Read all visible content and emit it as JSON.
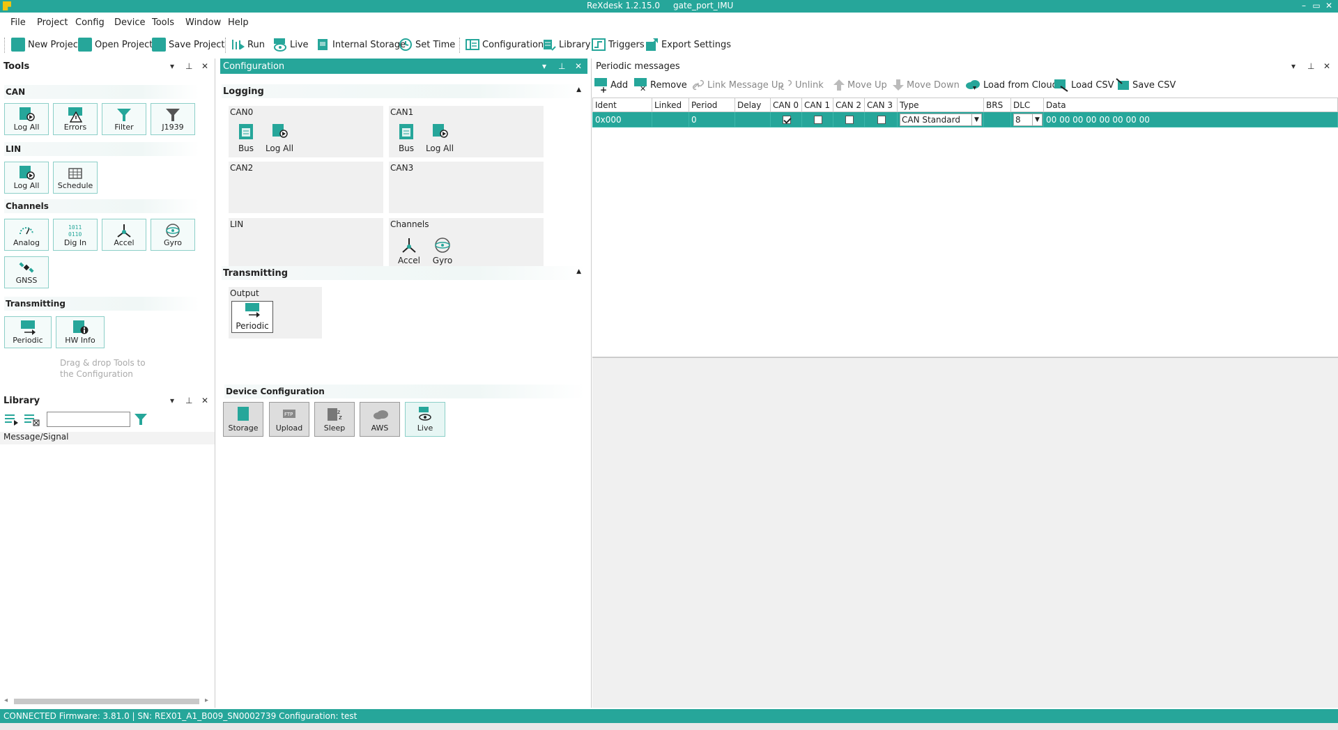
{
  "window": {
    "title": "ReXdesk 1.2.15.0",
    "project": "gate_port_IMU",
    "controls": [
      "–",
      "▭",
      "✕"
    ]
  },
  "menu": [
    "File",
    "Project",
    "Config",
    "Device",
    "Tools",
    "Window",
    "Help"
  ],
  "toolbar": {
    "new_project": "New Project",
    "open_project": "Open Project",
    "save_project": "Save Project",
    "run": "Run",
    "live": "Live",
    "internal_storage": "Internal Storage",
    "set_time": "Set Time",
    "configuration": "Configuration",
    "library": "Library",
    "triggers": "Triggers",
    "export_settings": "Export Settings"
  },
  "tools_panel": {
    "title": "Tools",
    "sections": {
      "can": "CAN",
      "lin": "LIN",
      "channels": "Channels",
      "transmitting": "Transmitting"
    },
    "can_items": [
      "Log All",
      "Errors",
      "Filter",
      "J1939"
    ],
    "lin_items": [
      "Log All",
      "Schedule"
    ],
    "channel_items": [
      "Analog",
      "Dig In",
      "Accel",
      "Gyro",
      "GNSS"
    ],
    "transmit_items": [
      "Periodic",
      "HW Info"
    ],
    "hint": "Drag & drop Tools to the Configuration"
  },
  "library_panel": {
    "title": "Library",
    "search_value": "",
    "column": "Message/Signal"
  },
  "config_panel": {
    "title": "Configuration",
    "logging": "Logging",
    "boxes": {
      "can0": "CAN0",
      "can1": "CAN1",
      "can2": "CAN2",
      "can3": "CAN3",
      "lin": "LIN",
      "channels": "Channels"
    },
    "can0_items": [
      "Bus",
      "Log All"
    ],
    "can1_items": [
      "Bus",
      "Log All"
    ],
    "channels_items": [
      "Accel",
      "Gyro"
    ],
    "transmitting": "Transmitting",
    "output": "Output",
    "output_items": [
      "Periodic"
    ],
    "device_configuration": "Device Configuration",
    "device_items": [
      "Storage",
      "Upload",
      "Sleep",
      "AWS",
      "Live"
    ]
  },
  "periodic_panel": {
    "title": "Periodic messages",
    "toolbar": {
      "add": "Add",
      "remove": "Remove",
      "link_up": "Link Message Up",
      "unlink": "Unlink",
      "move_up": "Move Up",
      "move_down": "Move Down",
      "load_cloud": "Load from Cloud",
      "load_csv": "Load CSV",
      "save_csv": "Save CSV"
    },
    "columns": [
      "Ident",
      "Linked",
      "Period",
      "Delay",
      "CAN 0",
      "CAN 1",
      "CAN 2",
      "CAN 3",
      "Type",
      "BRS",
      "DLC",
      "Data"
    ],
    "rows": [
      {
        "ident": "0x000",
        "linked": "",
        "period": "0",
        "delay": "",
        "can0": true,
        "can1": false,
        "can2": false,
        "can3": false,
        "type": "CAN Standard",
        "brs": "",
        "dlc": "8",
        "data": "00 00 00 00 00 00 00 00"
      }
    ]
  },
  "status": {
    "text": "CONNECTED  Firmware: 3.81.0   |  SN: REX01_A1_B009_SN0002739  Configuration: test"
  },
  "colors": {
    "accent": "#26a69a",
    "panel_bg": "#f0f0f0"
  }
}
